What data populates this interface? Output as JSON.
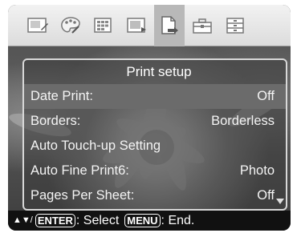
{
  "toolbar": {
    "icons": [
      {
        "name": "edit-icon"
      },
      {
        "name": "palette-icon"
      },
      {
        "name": "grid-icon"
      },
      {
        "name": "slideshow-icon"
      },
      {
        "name": "print-document-icon",
        "selected": true
      },
      {
        "name": "toolbox-icon"
      },
      {
        "name": "settings-list-icon"
      }
    ]
  },
  "dialog": {
    "title": "Print setup",
    "rows": [
      {
        "label": "Date Print:",
        "value": "Off",
        "selected": true
      },
      {
        "label": "Borders:",
        "value": "Borderless"
      },
      {
        "label": "Auto Touch-up Setting",
        "value": ""
      },
      {
        "label": "Auto Fine Print6:",
        "value": "Photo"
      },
      {
        "label": "Pages Per Sheet:",
        "value": "Off"
      }
    ]
  },
  "hint": {
    "arrows": "▲▼/",
    "enter_key": "ENTER",
    "select_text": ": Select",
    "menu_key": "MENU",
    "end_text": ": End."
  },
  "colors": {
    "selected_row": "#6b6b6b",
    "hint_bar": "#111111",
    "icon_bar": "#e6e6e6"
  }
}
